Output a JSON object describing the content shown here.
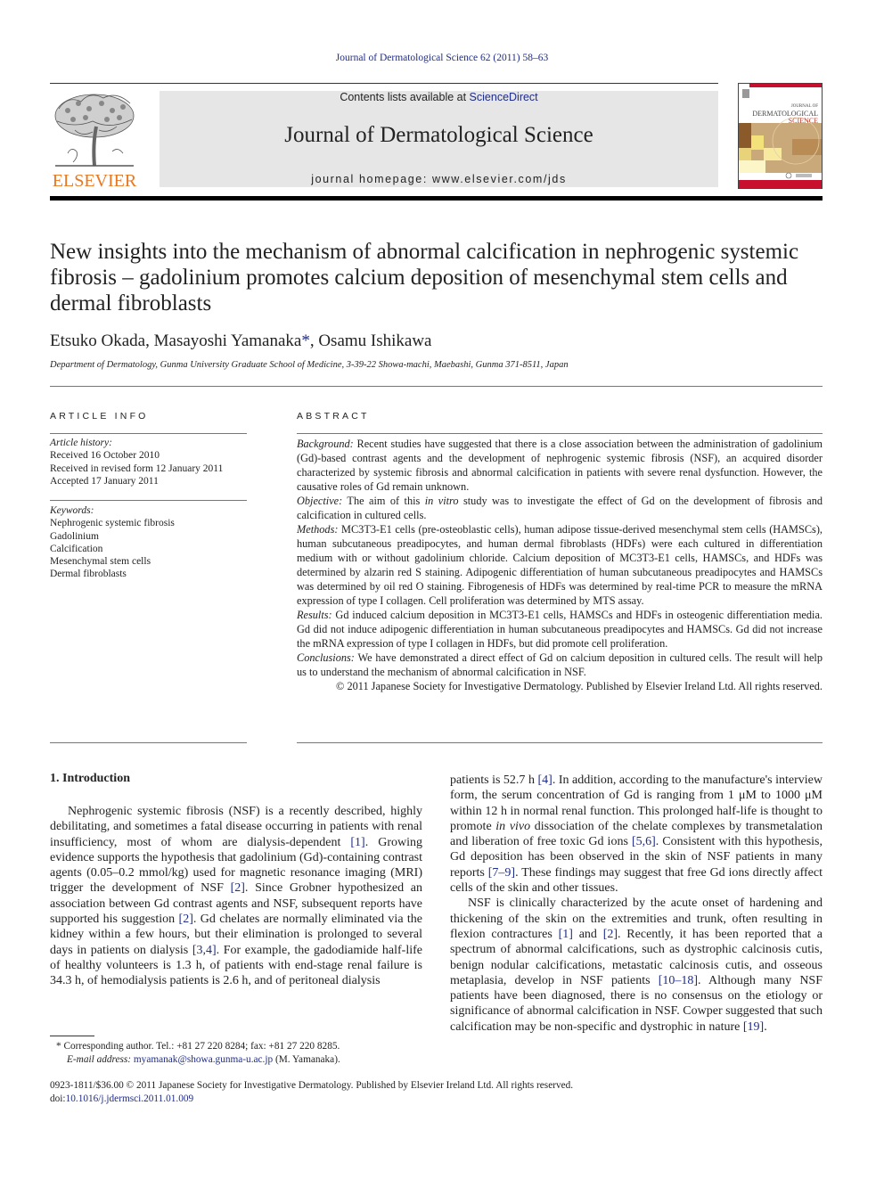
{
  "header": {
    "running_head": "Journal of Dermatological Science 62 (2011) 58–63",
    "contents_prefix": "Contents lists available at ",
    "contents_link": "ScienceDirect",
    "journal_title": "Journal of Dermatological Science",
    "homepage": "journal homepage: www.elsevier.com/jds",
    "publisher_logo": "ELSEVIER",
    "cover": {
      "line1": "JOURNAL OF",
      "line2": "DERMATOLOGICAL",
      "line3": "SCIENCE"
    }
  },
  "article": {
    "title": "New insights into the mechanism of abnormal calcification in nephrogenic systemic fibrosis – gadolinium promotes calcium deposition of mesenchymal stem cells and dermal fibroblasts",
    "authors": [
      {
        "name": "Etsuko Okada",
        "sep": ", "
      },
      {
        "name": "Masayoshi Yamanaka",
        "mark": "*",
        "sep": ", "
      },
      {
        "name": "Osamu Ishikawa",
        "sep": ""
      }
    ],
    "affiliation": "Department of Dermatology, Gunma University Graduate School of Medicine, 3-39-22 Showa-machi, Maebashi, Gunma 371-8511, Japan"
  },
  "article_info": {
    "heading": "ARTICLE INFO",
    "history_label": "Article history:",
    "history": [
      "Received 16 October 2010",
      "Received in revised form 12 January 2011",
      "Accepted 17 January 2011"
    ],
    "keywords_label": "Keywords:",
    "keywords": [
      "Nephrogenic systemic fibrosis",
      "Gadolinium",
      "Calcification",
      "Mesenchymal stem cells",
      "Dermal fibroblasts"
    ]
  },
  "abstract": {
    "heading": "ABSTRACT",
    "sections": [
      {
        "label": "Background:",
        "text": " Recent studies have suggested that there is a close association between the administration of gadolinium (Gd)-based contrast agents and the development of nephrogenic systemic fibrosis (NSF), an acquired disorder characterized by systemic fibrosis and abnormal calcification in patients with severe renal dysfunction. However, the causative roles of Gd remain unknown."
      },
      {
        "label": "Objective:",
        "text_pre": " The aim of this ",
        "text_italic": "in vitro",
        "text_post": " study was to investigate the effect of Gd on the development of fibrosis and calcification in cultured cells."
      },
      {
        "label": "Methods:",
        "text": " MC3T3-E1 cells (pre-osteoblastic cells), human adipose tissue-derived mesenchymal stem cells (HAMSCs), human subcutaneous preadipocytes, and human dermal fibroblasts (HDFs) were each cultured in differentiation medium with or without gadolinium chloride. Calcium deposition of MC3T3-E1 cells, HAMSCs, and HDFs was determined by alzarin red S staining. Adipogenic differentiation of human subcutaneous preadipocytes and HAMSCs was determined by oil red O staining. Fibrogenesis of HDFs was determined by real-time PCR to measure the mRNA expression of type I collagen. Cell proliferation was determined by MTS assay."
      },
      {
        "label": "Results:",
        "text": " Gd induced calcium deposition in MC3T3-E1 cells, HAMSCs and HDFs in osteogenic differentiation media. Gd did not induce adipogenic differentiation in human subcutaneous preadipocytes and HAMSCs. Gd did not increase the mRNA expression of type I collagen in HDFs, but did promote cell proliferation."
      },
      {
        "label": "Conclusions:",
        "text": " We have demonstrated a direct effect of Gd on calcium deposition in cultured cells. The result will help us to understand the mechanism of abnormal calcification in NSF."
      }
    ],
    "copyright": "© 2011 Japanese Society for Investigative Dermatology. Published by Elsevier Ireland Ltd. All rights reserved."
  },
  "body": {
    "section1_heading": "1.  Introduction",
    "left_col": [
      {
        "t": "Nephrogenic systemic fibrosis (NSF) is a recently described, highly debilitating, and sometimes a fatal disease occurring in patients with renal insufficiency, most of whom are dialysis-dependent "
      },
      {
        "ref": "[1]"
      },
      {
        "t": ". Growing evidence supports the hypothesis that gadolinium (Gd)-containing contrast agents (0.05–0.2 mmol/kg) used for magnetic resonance imaging (MRI) trigger the development of NSF "
      },
      {
        "ref": "[2]"
      },
      {
        "t": ". Since Grobner hypothesized an association between Gd contrast agents and NSF, subsequent reports have supported his suggestion "
      },
      {
        "ref": "[2]"
      },
      {
        "t": ". Gd chelates are normally eliminated via the kidney within a few hours, but their elimination is prolonged to several days in patients on dialysis "
      },
      {
        "ref": "[3,4]"
      },
      {
        "t": ". For example, the gadodiamide half-life of healthy volunteers is 1.3 h, of patients with end-stage renal failure is 34.3 h, of hemodialysis patients is 2.6 h, and of peritoneal dialysis"
      }
    ],
    "right_col_p1": [
      {
        "t": "patients is 52.7 h "
      },
      {
        "ref": "[4]"
      },
      {
        "t": ". In addition, according to the manufacture's interview form, the serum concentration of Gd is ranging from 1 μM to 1000 μM within 12 h in normal renal function. This prolonged half-life is thought to promote "
      },
      {
        "i": "in vivo"
      },
      {
        "t": " dissociation of the chelate complexes by transmetalation and liberation of free toxic Gd ions "
      },
      {
        "ref": "[5,6]"
      },
      {
        "t": ". Consistent with this hypothesis, Gd deposition has been observed in the skin of NSF patients in many reports "
      },
      {
        "ref": "[7–9]"
      },
      {
        "t": ". These findings may suggest that free Gd ions directly affect cells of the skin and other tissues."
      }
    ],
    "right_col_p2": [
      {
        "t": "NSF is clinically characterized by the acute onset of hardening and thickening of the skin on the extremities and trunk, often resulting in flexion contractures "
      },
      {
        "ref": "[1]"
      },
      {
        "t": " and "
      },
      {
        "ref": "[2]"
      },
      {
        "t": ". Recently, it has been reported that a spectrum of abnormal calcifications, such as dystrophic calcinosis cutis, benign nodular calcifications, metastatic calcinosis cutis, and osseous metaplasia, develop in NSF patients "
      },
      {
        "ref": "[10–18]"
      },
      {
        "t": ". Although many NSF patients have been diagnosed, there is no consensus on the etiology or significance of abnormal calcification in NSF. Cowper suggested that such calcification may be non-specific and dystrophic in nature "
      },
      {
        "ref": "[19]"
      },
      {
        "t": "."
      }
    ]
  },
  "footnote": {
    "mark": "*",
    "corresponding": "Corresponding author. Tel.: +81 27 220 8284; fax: +81 27 220 8285.",
    "email_label": "E-mail address:",
    "email": "myamanak@showa.gunma-u.ac.jp",
    "email_suffix": " (M. Yamanaka)."
  },
  "footer": {
    "issn_line": "0923-1811/$36.00 © 2011 Japanese Society for Investigative Dermatology. Published by Elsevier Ireland Ltd. All rights reserved.",
    "doi_prefix": "doi:",
    "doi": "10.1016/j.jdermsci.2011.01.009"
  },
  "colors": {
    "link": "#1f2d8a",
    "elsevier_orange": "#e87722",
    "banner_gray": "#e6e6e6"
  }
}
